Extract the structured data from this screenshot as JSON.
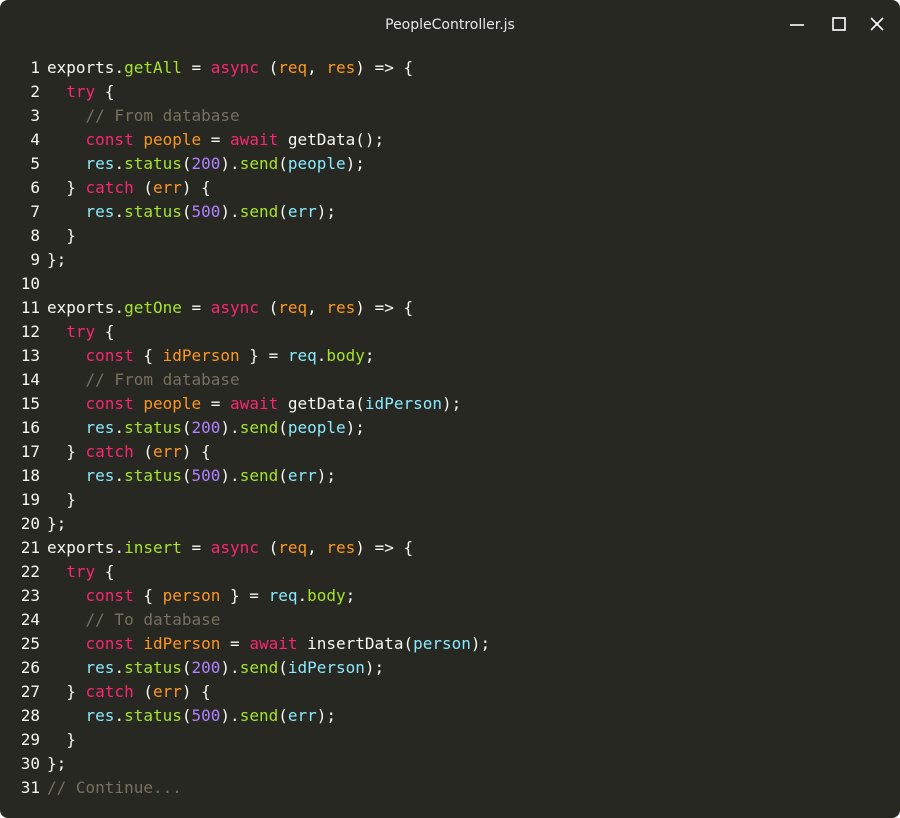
{
  "window": {
    "title": "PeopleController.js",
    "controls": {
      "minimize_icon": "minimize-icon",
      "maximize_icon": "maximize-icon",
      "close_icon": "close-icon"
    }
  },
  "theme": {
    "background": "#272822",
    "plain": "#f8f8f2",
    "keyword": "#f92672",
    "function": "#a6e22e",
    "param": "#fd971f",
    "variable": "#fd971f",
    "ident": "#8be9fd",
    "number": "#ae81ff",
    "comment": "#75715e"
  },
  "code": {
    "lines": [
      {
        "n": "1",
        "tokens": [
          {
            "t": "exports",
            "c": "plain"
          },
          {
            "t": ".",
            "c": "plain"
          },
          {
            "t": "getAll",
            "c": "function"
          },
          {
            "t": " = ",
            "c": "plain"
          },
          {
            "t": "async",
            "c": "keyword"
          },
          {
            "t": " (",
            "c": "plain"
          },
          {
            "t": "req",
            "c": "param"
          },
          {
            "t": ", ",
            "c": "plain"
          },
          {
            "t": "res",
            "c": "param"
          },
          {
            "t": ") => {",
            "c": "plain"
          }
        ]
      },
      {
        "n": "2",
        "tokens": [
          {
            "t": "  ",
            "c": "plain"
          },
          {
            "t": "try",
            "c": "keyword"
          },
          {
            "t": " {",
            "c": "plain"
          }
        ]
      },
      {
        "n": "3",
        "tokens": [
          {
            "t": "    ",
            "c": "plain"
          },
          {
            "t": "// From database",
            "c": "comment"
          }
        ]
      },
      {
        "n": "4",
        "tokens": [
          {
            "t": "    ",
            "c": "plain"
          },
          {
            "t": "const",
            "c": "keyword"
          },
          {
            "t": " ",
            "c": "plain"
          },
          {
            "t": "people",
            "c": "variable"
          },
          {
            "t": " = ",
            "c": "plain"
          },
          {
            "t": "await",
            "c": "keyword"
          },
          {
            "t": " getData();",
            "c": "plain"
          }
        ]
      },
      {
        "n": "5",
        "tokens": [
          {
            "t": "    ",
            "c": "plain"
          },
          {
            "t": "res",
            "c": "ident"
          },
          {
            "t": ".",
            "c": "plain"
          },
          {
            "t": "status",
            "c": "function"
          },
          {
            "t": "(",
            "c": "plain"
          },
          {
            "t": "200",
            "c": "number"
          },
          {
            "t": ").",
            "c": "plain"
          },
          {
            "t": "send",
            "c": "function"
          },
          {
            "t": "(",
            "c": "plain"
          },
          {
            "t": "people",
            "c": "ident"
          },
          {
            "t": ");",
            "c": "plain"
          }
        ]
      },
      {
        "n": "6",
        "tokens": [
          {
            "t": "  } ",
            "c": "plain"
          },
          {
            "t": "catch",
            "c": "keyword"
          },
          {
            "t": " (",
            "c": "plain"
          },
          {
            "t": "err",
            "c": "param"
          },
          {
            "t": ") {",
            "c": "plain"
          }
        ]
      },
      {
        "n": "7",
        "tokens": [
          {
            "t": "    ",
            "c": "plain"
          },
          {
            "t": "res",
            "c": "ident"
          },
          {
            "t": ".",
            "c": "plain"
          },
          {
            "t": "status",
            "c": "function"
          },
          {
            "t": "(",
            "c": "plain"
          },
          {
            "t": "500",
            "c": "number"
          },
          {
            "t": ").",
            "c": "plain"
          },
          {
            "t": "send",
            "c": "function"
          },
          {
            "t": "(",
            "c": "plain"
          },
          {
            "t": "err",
            "c": "ident"
          },
          {
            "t": ");",
            "c": "plain"
          }
        ]
      },
      {
        "n": "8",
        "tokens": [
          {
            "t": "  }",
            "c": "plain"
          }
        ]
      },
      {
        "n": "9",
        "tokens": [
          {
            "t": "};",
            "c": "plain"
          }
        ]
      },
      {
        "n": "10",
        "tokens": []
      },
      {
        "n": "11",
        "tokens": [
          {
            "t": "exports",
            "c": "plain"
          },
          {
            "t": ".",
            "c": "plain"
          },
          {
            "t": "getOne",
            "c": "function"
          },
          {
            "t": " = ",
            "c": "plain"
          },
          {
            "t": "async",
            "c": "keyword"
          },
          {
            "t": " (",
            "c": "plain"
          },
          {
            "t": "req",
            "c": "param"
          },
          {
            "t": ", ",
            "c": "plain"
          },
          {
            "t": "res",
            "c": "param"
          },
          {
            "t": ") => {",
            "c": "plain"
          }
        ]
      },
      {
        "n": "12",
        "tokens": [
          {
            "t": "  ",
            "c": "plain"
          },
          {
            "t": "try",
            "c": "keyword"
          },
          {
            "t": " {",
            "c": "plain"
          }
        ]
      },
      {
        "n": "13",
        "tokens": [
          {
            "t": "    ",
            "c": "plain"
          },
          {
            "t": "const",
            "c": "keyword"
          },
          {
            "t": " { ",
            "c": "plain"
          },
          {
            "t": "idPerson",
            "c": "variable"
          },
          {
            "t": " } = ",
            "c": "plain"
          },
          {
            "t": "req",
            "c": "ident"
          },
          {
            "t": ".",
            "c": "plain"
          },
          {
            "t": "body",
            "c": "function"
          },
          {
            "t": ";",
            "c": "plain"
          }
        ]
      },
      {
        "n": "14",
        "tokens": [
          {
            "t": "    ",
            "c": "plain"
          },
          {
            "t": "// From database",
            "c": "comment"
          }
        ]
      },
      {
        "n": "15",
        "tokens": [
          {
            "t": "    ",
            "c": "plain"
          },
          {
            "t": "const",
            "c": "keyword"
          },
          {
            "t": " ",
            "c": "plain"
          },
          {
            "t": "people",
            "c": "variable"
          },
          {
            "t": " = ",
            "c": "plain"
          },
          {
            "t": "await",
            "c": "keyword"
          },
          {
            "t": " getData(",
            "c": "plain"
          },
          {
            "t": "idPerson",
            "c": "ident"
          },
          {
            "t": ");",
            "c": "plain"
          }
        ]
      },
      {
        "n": "16",
        "tokens": [
          {
            "t": "    ",
            "c": "plain"
          },
          {
            "t": "res",
            "c": "ident"
          },
          {
            "t": ".",
            "c": "plain"
          },
          {
            "t": "status",
            "c": "function"
          },
          {
            "t": "(",
            "c": "plain"
          },
          {
            "t": "200",
            "c": "number"
          },
          {
            "t": ").",
            "c": "plain"
          },
          {
            "t": "send",
            "c": "function"
          },
          {
            "t": "(",
            "c": "plain"
          },
          {
            "t": "people",
            "c": "ident"
          },
          {
            "t": ");",
            "c": "plain"
          }
        ]
      },
      {
        "n": "17",
        "tokens": [
          {
            "t": "  } ",
            "c": "plain"
          },
          {
            "t": "catch",
            "c": "keyword"
          },
          {
            "t": " (",
            "c": "plain"
          },
          {
            "t": "err",
            "c": "param"
          },
          {
            "t": ") {",
            "c": "plain"
          }
        ]
      },
      {
        "n": "18",
        "tokens": [
          {
            "t": "    ",
            "c": "plain"
          },
          {
            "t": "res",
            "c": "ident"
          },
          {
            "t": ".",
            "c": "plain"
          },
          {
            "t": "status",
            "c": "function"
          },
          {
            "t": "(",
            "c": "plain"
          },
          {
            "t": "500",
            "c": "number"
          },
          {
            "t": ").",
            "c": "plain"
          },
          {
            "t": "send",
            "c": "function"
          },
          {
            "t": "(",
            "c": "plain"
          },
          {
            "t": "err",
            "c": "ident"
          },
          {
            "t": ");",
            "c": "plain"
          }
        ]
      },
      {
        "n": "19",
        "tokens": [
          {
            "t": "  }",
            "c": "plain"
          }
        ]
      },
      {
        "n": "20",
        "tokens": [
          {
            "t": "};",
            "c": "plain"
          }
        ]
      },
      {
        "n": "21",
        "tokens": [
          {
            "t": "exports",
            "c": "plain"
          },
          {
            "t": ".",
            "c": "plain"
          },
          {
            "t": "insert",
            "c": "function"
          },
          {
            "t": " = ",
            "c": "plain"
          },
          {
            "t": "async",
            "c": "keyword"
          },
          {
            "t": " (",
            "c": "plain"
          },
          {
            "t": "req",
            "c": "param"
          },
          {
            "t": ", ",
            "c": "plain"
          },
          {
            "t": "res",
            "c": "param"
          },
          {
            "t": ") => {",
            "c": "plain"
          }
        ]
      },
      {
        "n": "22",
        "tokens": [
          {
            "t": "  ",
            "c": "plain"
          },
          {
            "t": "try",
            "c": "keyword"
          },
          {
            "t": " {",
            "c": "plain"
          }
        ]
      },
      {
        "n": "23",
        "tokens": [
          {
            "t": "    ",
            "c": "plain"
          },
          {
            "t": "const",
            "c": "keyword"
          },
          {
            "t": " { ",
            "c": "plain"
          },
          {
            "t": "person",
            "c": "variable"
          },
          {
            "t": " } = ",
            "c": "plain"
          },
          {
            "t": "req",
            "c": "ident"
          },
          {
            "t": ".",
            "c": "plain"
          },
          {
            "t": "body",
            "c": "function"
          },
          {
            "t": ";",
            "c": "plain"
          }
        ]
      },
      {
        "n": "24",
        "tokens": [
          {
            "t": "    ",
            "c": "plain"
          },
          {
            "t": "// To database",
            "c": "comment"
          }
        ]
      },
      {
        "n": "25",
        "tokens": [
          {
            "t": "    ",
            "c": "plain"
          },
          {
            "t": "const",
            "c": "keyword"
          },
          {
            "t": " ",
            "c": "plain"
          },
          {
            "t": "idPerson",
            "c": "variable"
          },
          {
            "t": " = ",
            "c": "plain"
          },
          {
            "t": "await",
            "c": "keyword"
          },
          {
            "t": " insertData(",
            "c": "plain"
          },
          {
            "t": "person",
            "c": "ident"
          },
          {
            "t": ");",
            "c": "plain"
          }
        ]
      },
      {
        "n": "26",
        "tokens": [
          {
            "t": "    ",
            "c": "plain"
          },
          {
            "t": "res",
            "c": "ident"
          },
          {
            "t": ".",
            "c": "plain"
          },
          {
            "t": "status",
            "c": "function"
          },
          {
            "t": "(",
            "c": "plain"
          },
          {
            "t": "200",
            "c": "number"
          },
          {
            "t": ").",
            "c": "plain"
          },
          {
            "t": "send",
            "c": "function"
          },
          {
            "t": "(",
            "c": "plain"
          },
          {
            "t": "idPerson",
            "c": "ident"
          },
          {
            "t": ");",
            "c": "plain"
          }
        ]
      },
      {
        "n": "27",
        "tokens": [
          {
            "t": "  } ",
            "c": "plain"
          },
          {
            "t": "catch",
            "c": "keyword"
          },
          {
            "t": " (",
            "c": "plain"
          },
          {
            "t": "err",
            "c": "param"
          },
          {
            "t": ") {",
            "c": "plain"
          }
        ]
      },
      {
        "n": "28",
        "tokens": [
          {
            "t": "    ",
            "c": "plain"
          },
          {
            "t": "res",
            "c": "ident"
          },
          {
            "t": ".",
            "c": "plain"
          },
          {
            "t": "status",
            "c": "function"
          },
          {
            "t": "(",
            "c": "plain"
          },
          {
            "t": "500",
            "c": "number"
          },
          {
            "t": ").",
            "c": "plain"
          },
          {
            "t": "send",
            "c": "function"
          },
          {
            "t": "(",
            "c": "plain"
          },
          {
            "t": "err",
            "c": "ident"
          },
          {
            "t": ");",
            "c": "plain"
          }
        ]
      },
      {
        "n": "29",
        "tokens": [
          {
            "t": "  }",
            "c": "plain"
          }
        ]
      },
      {
        "n": "30",
        "tokens": [
          {
            "t": "};",
            "c": "plain"
          }
        ]
      },
      {
        "n": "31",
        "tokens": [
          {
            "t": "// Continue...",
            "c": "comment"
          }
        ]
      }
    ]
  }
}
